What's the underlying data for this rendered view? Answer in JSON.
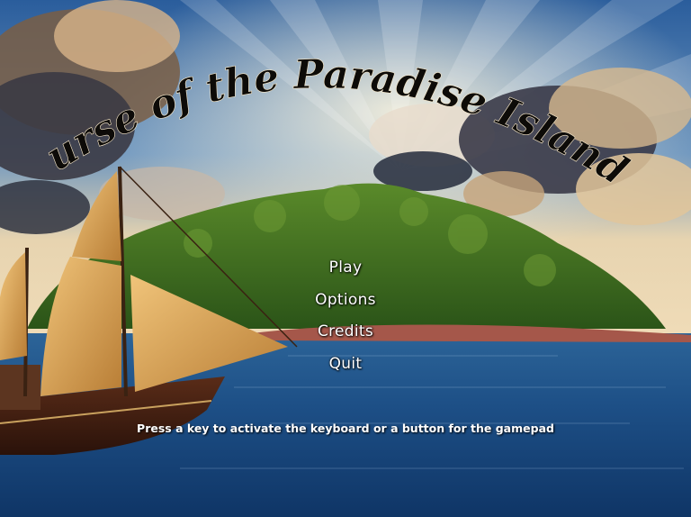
{
  "game": {
    "title": "Curse of the Paradise Islands"
  },
  "menu": {
    "items": [
      {
        "label": "Play"
      },
      {
        "label": "Options"
      },
      {
        "label": "Credits"
      },
      {
        "label": "Quit"
      }
    ]
  },
  "hint": "Press a key to activate the keyboard or a button for the gamepad",
  "colors": {
    "sky": "#3d6fa8",
    "sea": "#1a4f85",
    "island": "#3f6e22",
    "title": "#0d0b08",
    "sail": "#d9a24f"
  }
}
